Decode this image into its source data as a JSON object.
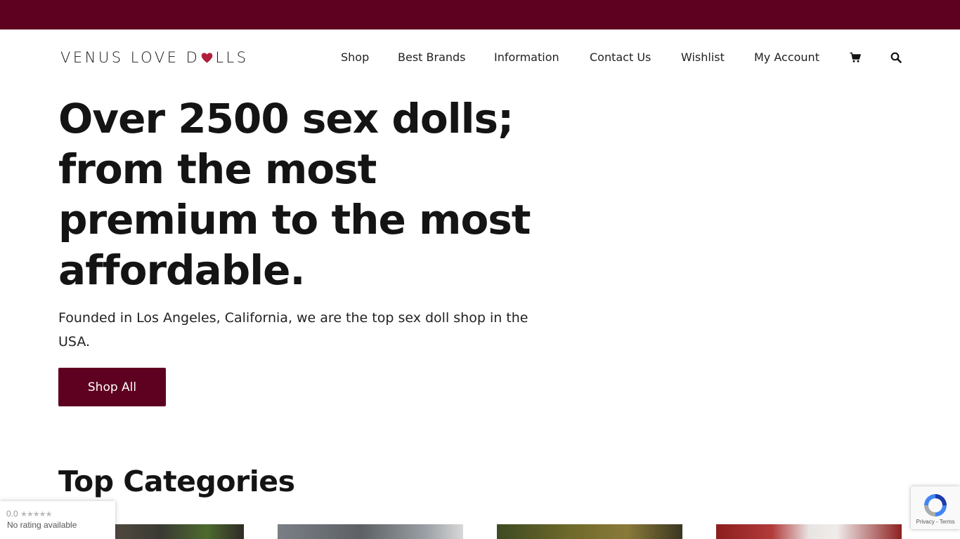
{
  "brand": {
    "logo_text_left": "VENUS LOVE D",
    "logo_text_right": "LLS",
    "heart_color": "#b0203a"
  },
  "colors": {
    "accent": "#5e0020",
    "text": "#141414"
  },
  "nav": {
    "items": [
      {
        "label": "Shop"
      },
      {
        "label": "Best Brands"
      },
      {
        "label": "Information"
      },
      {
        "label": "Contact Us"
      },
      {
        "label": "Wishlist"
      },
      {
        "label": "My Account"
      }
    ],
    "cart_icon": "shopping-cart-icon",
    "search_icon": "search-icon"
  },
  "hero": {
    "title": "Over 2500 sex dolls; from the most premium to the most affordable.",
    "subtitle": "Founded in Los Angeles, California, we are the top sex doll shop in the USA.",
    "button_label": "Shop All"
  },
  "categories": {
    "title": "Top Categories"
  },
  "rating_badge": {
    "score": "0.0",
    "stars": "★★★★★",
    "text": "No rating available"
  },
  "recaptcha": {
    "icon": "recaptcha-icon",
    "privacy": "Privacy",
    "separator": " - ",
    "terms": "Terms"
  }
}
